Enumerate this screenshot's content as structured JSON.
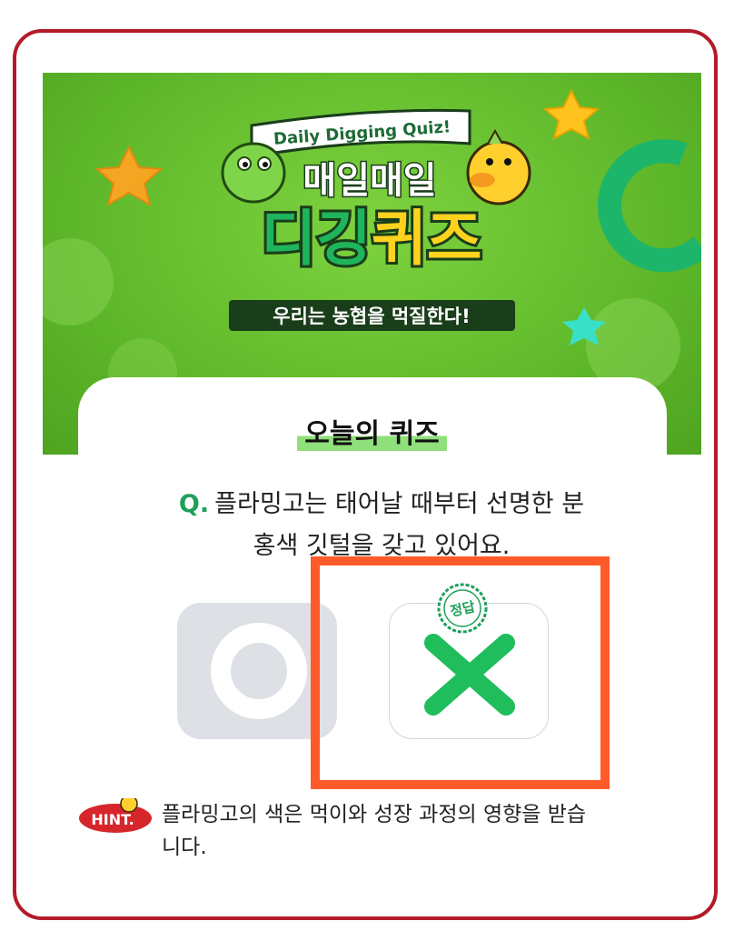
{
  "banner": {
    "tagline_en": "Daily Digging Quiz!",
    "title_line1": "매일매일",
    "title_line2a": "디깅",
    "title_line2b": "퀴즈",
    "subtitle": "우리는 농협을 먹질한다!"
  },
  "quiz": {
    "section_title": "오늘의 퀴즈",
    "q_prefix": "Q.",
    "question_line1": "플라밍고는 태어날 때부터 선명한 분",
    "question_line2": "홍색 깃털을 갖고 있어요."
  },
  "options": {
    "o_symbol": "O",
    "x_symbol": "X",
    "correct_stamp": "정답"
  },
  "hint": {
    "label": "HINT.",
    "text_line1": "플라밍고의 색은 먹이와 성장 과정의 영향을 받습",
    "text_line2": "니다."
  },
  "colors": {
    "frame": "#b31b28",
    "banner_green": "#62bb2c",
    "accent_green": "#1fa05a",
    "highlight": "#ff5a2a",
    "hint_red": "#d6262b"
  }
}
